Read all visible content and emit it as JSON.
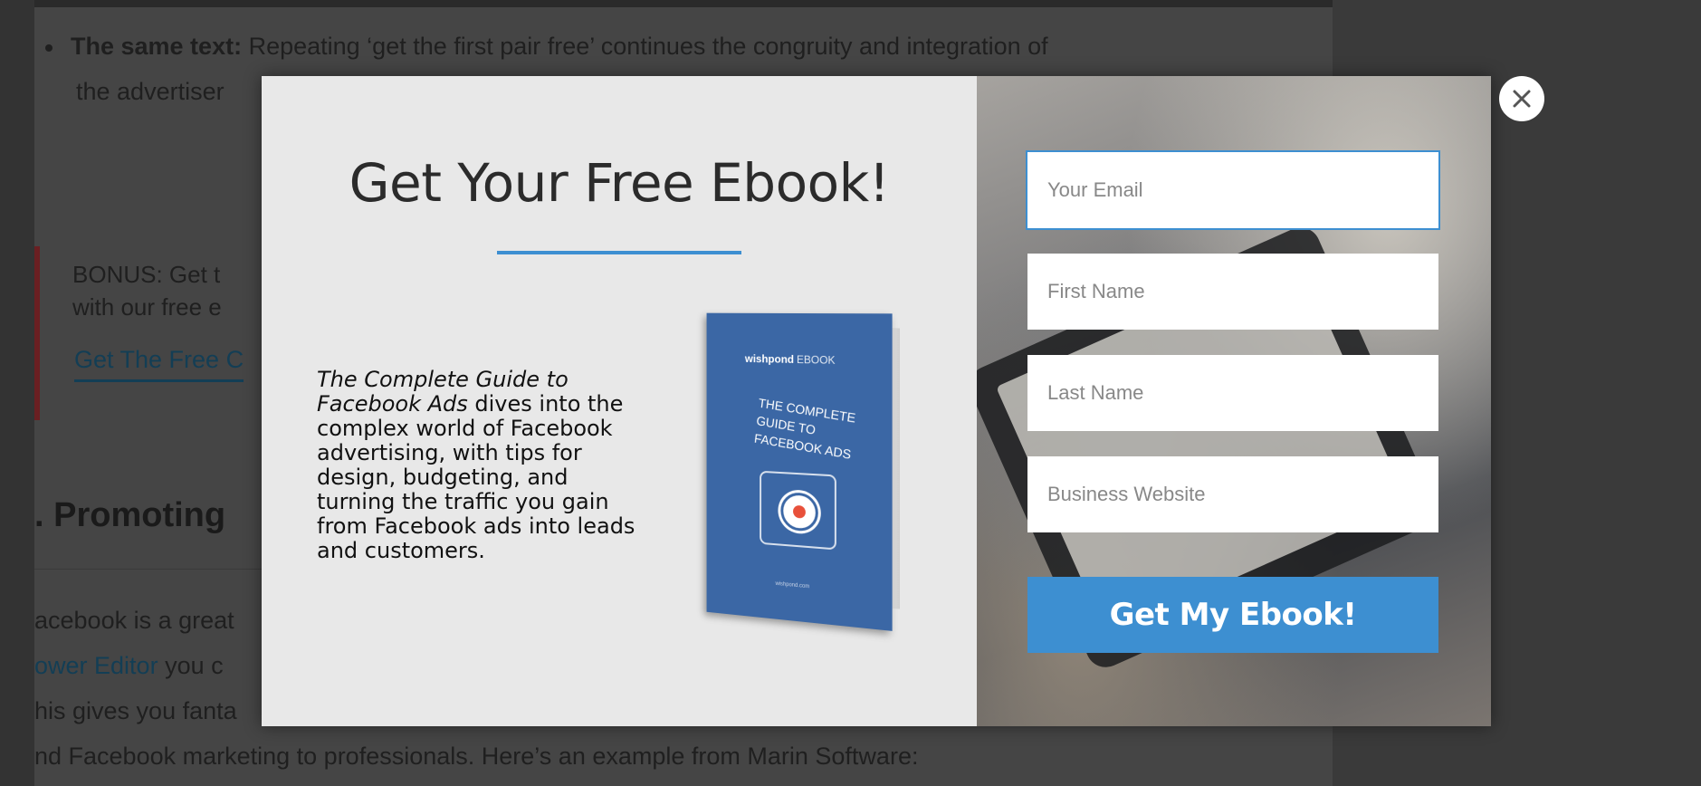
{
  "article": {
    "bullet_bold": "The same text:",
    "bullet_rest": " Repeating ‘get the first pair free’ continues the congruity and integration of",
    "bullet_line2": "the advertiser",
    "bonus_text_1": "BONUS:  Get t",
    "bonus_text_2": "with our free e",
    "bonus_link": "Get The Free C",
    "heading": ". Promoting",
    "para_1": "acebook is a great",
    "para_2_link": "ower Editor",
    "para_2_rest": " you c",
    "para_3": "his gives you fanta",
    "para_4": "nd Facebook marketing to professionals. Here’s an example from Marin Software:"
  },
  "modal": {
    "title": "Get Your Free Ebook!",
    "desc_italic": "The Complete Guide to Facebook Ads",
    "desc_rest": " dives into the complex world of Facebook advertising, with tips for design, budgeting, and turning the traffic you gain from Facebook ads into leads and customers.",
    "book": {
      "brand": "wishpond",
      "brand_suffix": "EBOOK",
      "title": "THE COMPLETE\nGUIDE TO\nFACEBOOK ADS",
      "footer": "wishpond.com"
    },
    "form": {
      "email_placeholder": "Your Email",
      "first_name_placeholder": "First Name",
      "last_name_placeholder": "Last Name",
      "website_placeholder": "Business Website",
      "submit_label": "Get My Ebook!"
    },
    "accent_color": "#3d8fd1"
  },
  "close_icon": "close-icon"
}
